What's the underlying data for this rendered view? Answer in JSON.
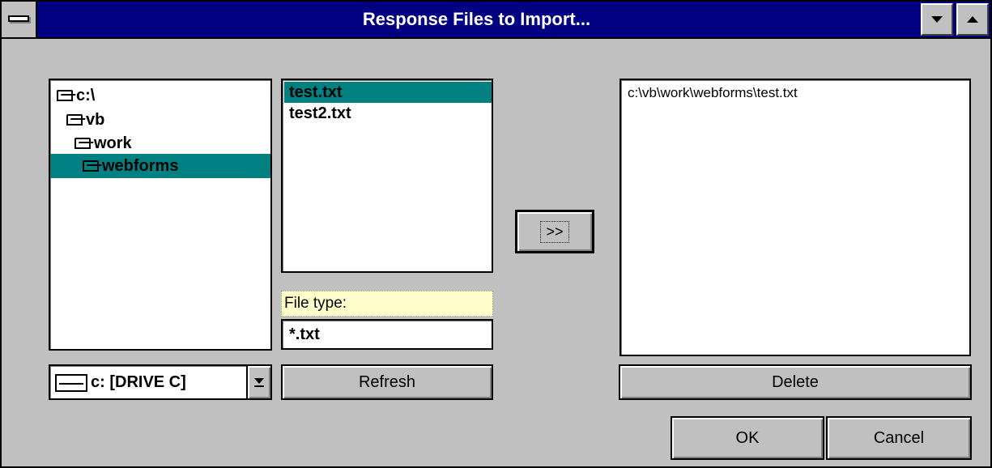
{
  "window": {
    "title": "Response Files to Import..."
  },
  "directory_tree": {
    "items": [
      {
        "label": "c:\\",
        "indent": 0,
        "selected": false
      },
      {
        "label": "vb",
        "indent": 1,
        "selected": false
      },
      {
        "label": "work",
        "indent": 2,
        "selected": false
      },
      {
        "label": "webforms",
        "indent": 3,
        "selected": true
      }
    ]
  },
  "drive_select": {
    "value": "c: [DRIVE C]"
  },
  "file_list": {
    "items": [
      {
        "label": "test.txt",
        "selected": true
      },
      {
        "label": "test2.txt",
        "selected": false
      }
    ]
  },
  "file_type": {
    "label": "File type:",
    "value": "*.txt"
  },
  "buttons": {
    "refresh": "Refresh",
    "add": ">>",
    "delete": "Delete",
    "ok": "OK",
    "cancel": "Cancel"
  },
  "import_list": {
    "items": [
      "c:\\vb\\work\\webforms\\test.txt"
    ]
  },
  "colors": {
    "title_bar": "#000080",
    "selection": "#008080",
    "window_face": "#c0c0c0",
    "label_highlight": "#ffffcc"
  }
}
